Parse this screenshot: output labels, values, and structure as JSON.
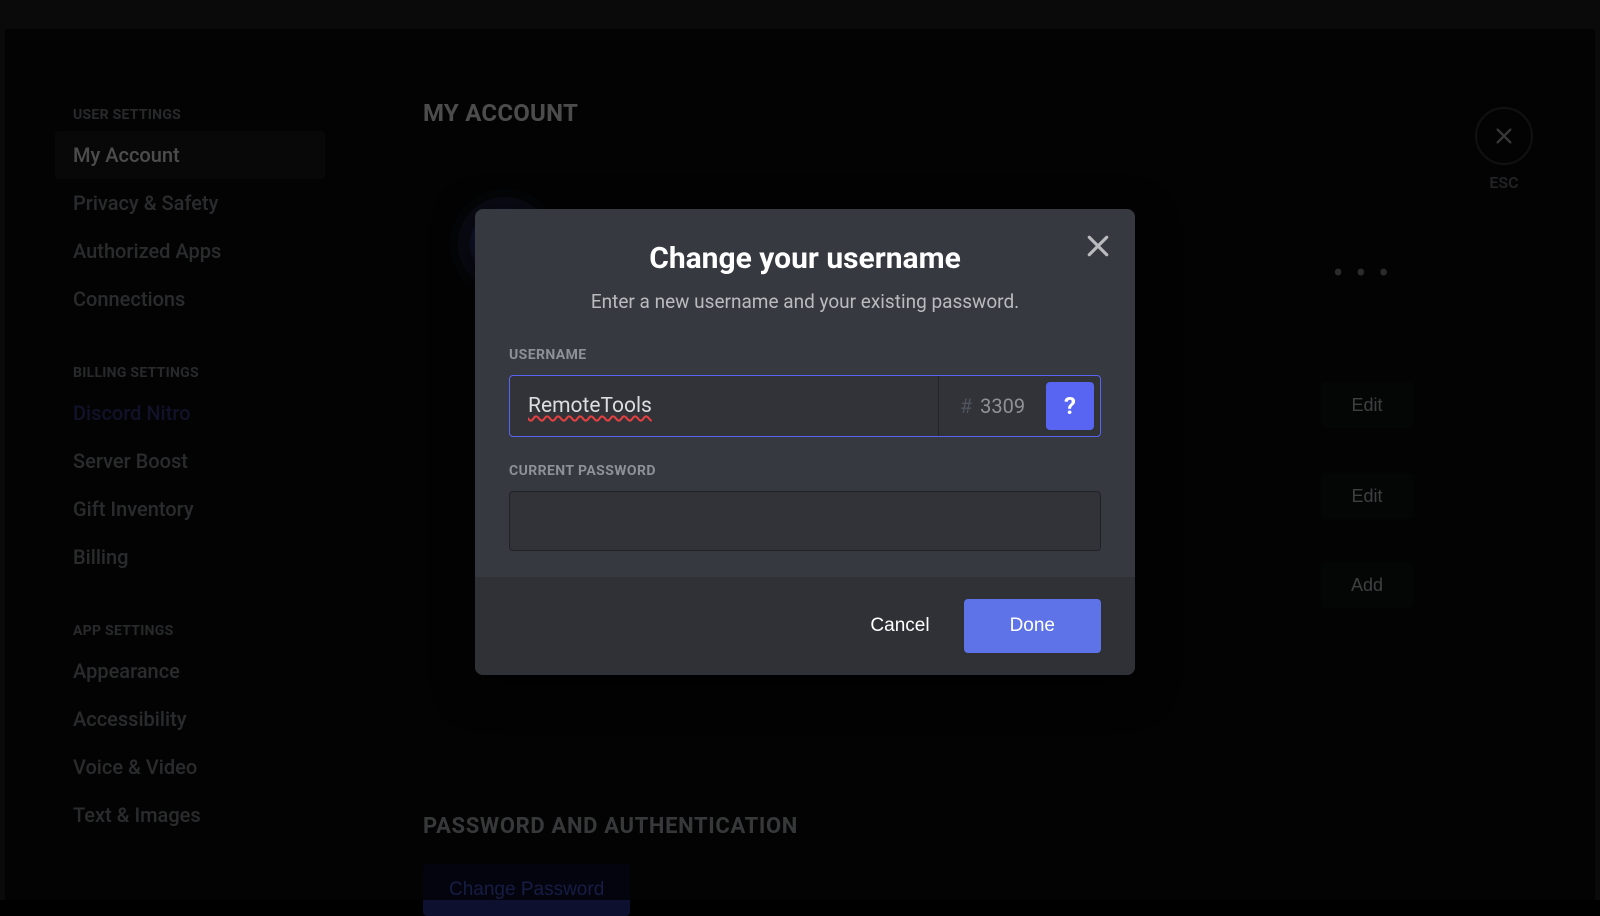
{
  "sidebar": {
    "heading_user": "USER SETTINGS",
    "heading_billing": "BILLING SETTINGS",
    "heading_app": "APP SETTINGS",
    "items_user": [
      {
        "label": "My Account"
      },
      {
        "label": "Privacy & Safety"
      },
      {
        "label": "Authorized Apps"
      },
      {
        "label": "Connections"
      }
    ],
    "items_billing": [
      {
        "label": "Discord Nitro"
      },
      {
        "label": "Server Boost"
      },
      {
        "label": "Gift Inventory"
      },
      {
        "label": "Billing"
      }
    ],
    "items_app": [
      {
        "label": "Appearance"
      },
      {
        "label": "Accessibility"
      },
      {
        "label": "Voice & Video"
      },
      {
        "label": "Text & Images"
      }
    ]
  },
  "main": {
    "title": "MY ACCOUNT",
    "edit_label": "Edit",
    "add_label": "Add",
    "more": "• • •",
    "pw_heading": "PASSWORD AND AUTHENTICATION",
    "change_pw": "Change Password",
    "esc": "ESC"
  },
  "modal": {
    "title": "Change your username",
    "subtitle": "Enter a new username and your existing password.",
    "username_label": "USERNAME",
    "username_value": "RemoteTools",
    "discriminator_hash": "#",
    "discriminator": "3309",
    "help": "?",
    "password_label": "CURRENT PASSWORD",
    "password_value": "",
    "cancel": "Cancel",
    "done": "Done"
  }
}
